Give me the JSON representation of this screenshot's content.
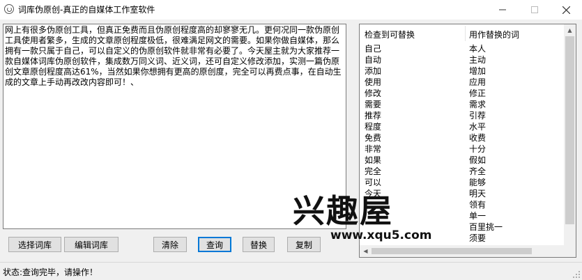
{
  "window": {
    "title": "词库伪原创-真正的自媒体工作室软件"
  },
  "editor": {
    "text": "网上有很多伪原创工具，但真正免费而且伪原创程度高的却寥寥无几。更何况同一款伪原创工具使用者繁多，生成的文章原创程度极低，很难满足网文的需要。如果你做自媒体，那么拥有一款只属于自己，可以自定义的伪原创软件就非常有必要了。今天屋主就为大家推荐一款自媒体词库伪原创软件，集成数万同义词、近义词，还可自定义修改添加，实测一篇伪原创文章原创程度高达61%，当然如果你想拥有更高的原创度，完全可以再费点事，在自动生成的文章上手动再改改内容即可！、"
  },
  "buttons": {
    "select_library": "选择词库",
    "edit_library": "编辑词库",
    "clear": "清除",
    "query": "查询",
    "replace": "替换",
    "copy": "复制"
  },
  "list": {
    "col1_header": "检查到可替换",
    "col2_header": "用作替换的词",
    "rows": [
      {
        "from": "自己",
        "to": "本人"
      },
      {
        "from": "自动",
        "to": "主动"
      },
      {
        "from": "添加",
        "to": "增加"
      },
      {
        "from": "使用",
        "to": "应用"
      },
      {
        "from": "修改",
        "to": "修正"
      },
      {
        "from": "需要",
        "to": "需求"
      },
      {
        "from": "推荐",
        "to": "引荐"
      },
      {
        "from": "程度",
        "to": "水平"
      },
      {
        "from": "免费",
        "to": "收费"
      },
      {
        "from": "非常",
        "to": "十分"
      },
      {
        "from": "如果",
        "to": "假如"
      },
      {
        "from": "完全",
        "to": "齐全"
      },
      {
        "from": "可以",
        "to": "能够"
      },
      {
        "from": "今天",
        "to": "明天"
      },
      {
        "from": "",
        "to": "领有"
      },
      {
        "from": "",
        "to": "单一"
      },
      {
        "from": "",
        "to": "百里挑一"
      },
      {
        "from": "",
        "to": "须要"
      }
    ]
  },
  "status": {
    "text": "状态:查询完毕，请操作！"
  },
  "watermark": {
    "logo": "兴趣屋",
    "url": "www.xqu5.com"
  }
}
